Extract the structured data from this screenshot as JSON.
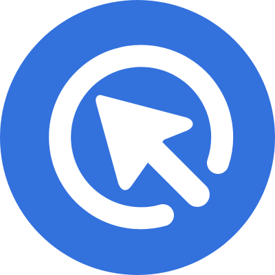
{
  "icon": {
    "name": "cursor-click-icon",
    "colors": {
      "background": "#3371DD",
      "foreground": "#FFFFFF"
    }
  }
}
